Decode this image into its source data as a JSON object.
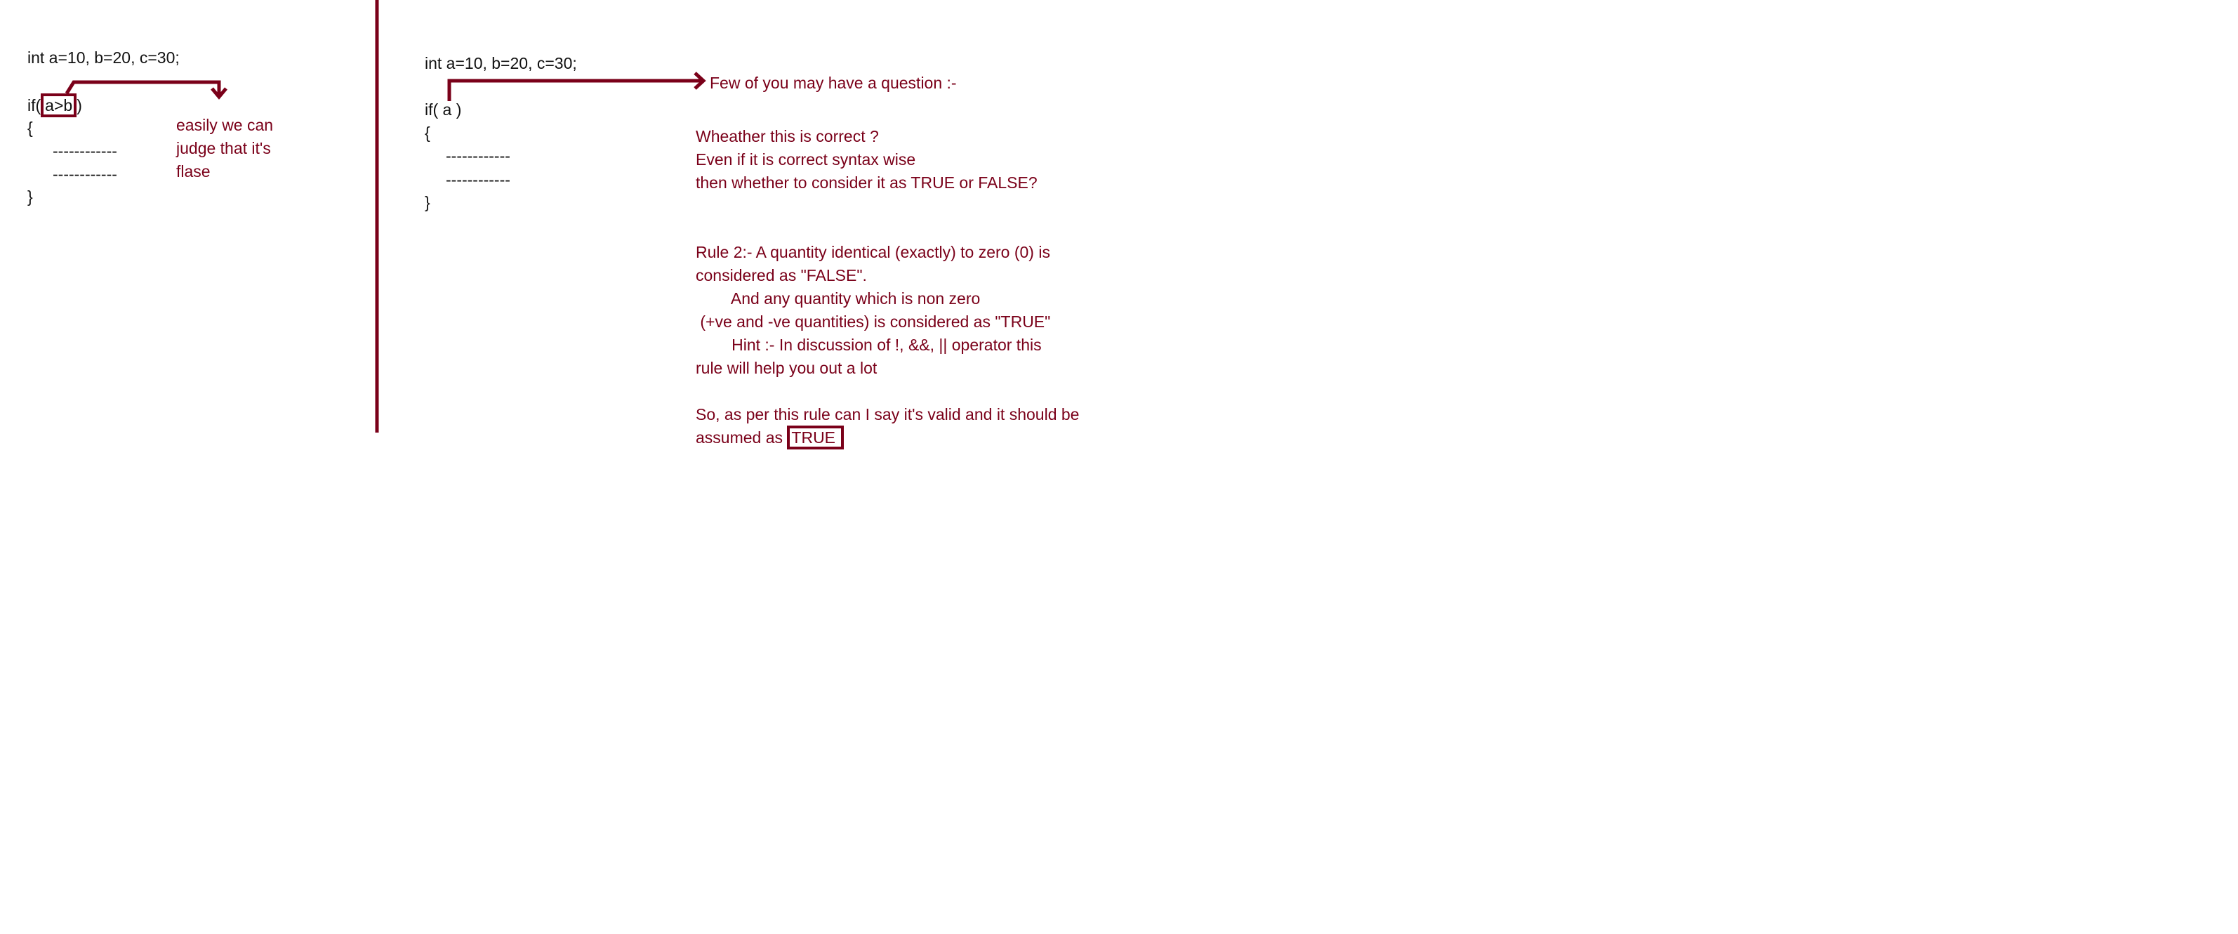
{
  "left_panel": {
    "declaration": "int a=10, b=20, c=30;",
    "if_prefix": "if(",
    "condition": "a>b",
    "if_suffix": ")",
    "open_brace": "{",
    "body_lines": [
      "------------",
      "------------"
    ],
    "close_brace": "}",
    "note_lines": [
      "easily we can",
      "judge that it's",
      "flase"
    ]
  },
  "right_panel": {
    "declaration": "int a=10, b=20, c=30;",
    "if_line": "if( a )",
    "open_brace": "{",
    "body_lines": [
      "------------",
      "------------"
    ],
    "close_brace": "}",
    "question_header": "Few of you may have a question :-",
    "question_lines": [
      "Wheather this is correct ?",
      "Even if it is correct syntax wise",
      "then whether to consider it as TRUE or FALSE?"
    ],
    "rule_lines": [
      "Rule 2:- A quantity identical (exactly) to zero (0) is",
      "considered as \"FALSE\".",
      "        And any quantity which is non zero",
      " (+ve and -ve quantities) is considered as \"TRUE\"",
      "        Hint :- In discussion of !, &&, || operator this",
      "rule will help you out a lot"
    ],
    "conclusion_line1": "So, as per this rule can I say it's valid and it should be",
    "conclusion_prefix": "assumed as ",
    "conclusion_answer": "TRUE "
  },
  "colors": {
    "accent": "#7a0019",
    "code_text": "#111111",
    "background": "#ffffff"
  }
}
